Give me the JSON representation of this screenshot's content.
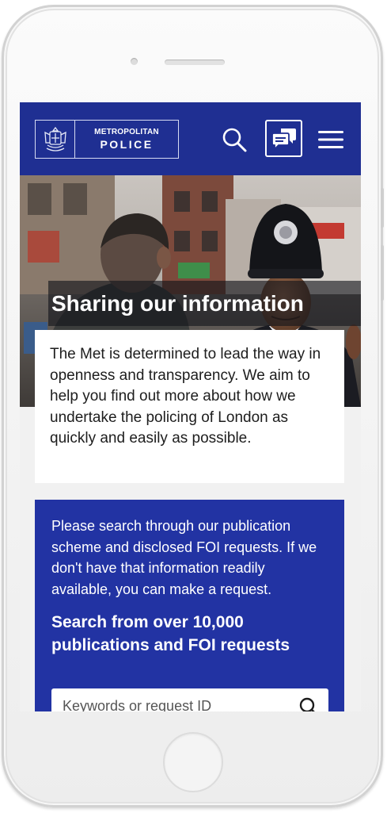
{
  "header": {
    "logo_line1": "METROPOLITAN",
    "logo_line2": "POLICE",
    "brand_color": "#1f2f92",
    "icons": [
      "crest-icon",
      "search-icon",
      "chat-icon",
      "menu-icon"
    ]
  },
  "hero": {
    "title": "Sharing our information"
  },
  "intro": {
    "text": "The Met is determined to lead the way in openness and transparency. We aim to help you find out more about how we undertake the policing of London as quickly and easily as possible."
  },
  "search": {
    "description": "Please search through our publication scheme and disclosed FOI requests. If we don't have that information readily available, you can make a request.",
    "heading": "Search from over 10,000 publications and FOI requests",
    "placeholder": "Keywords or request ID",
    "panel_color": "#2233a3"
  }
}
